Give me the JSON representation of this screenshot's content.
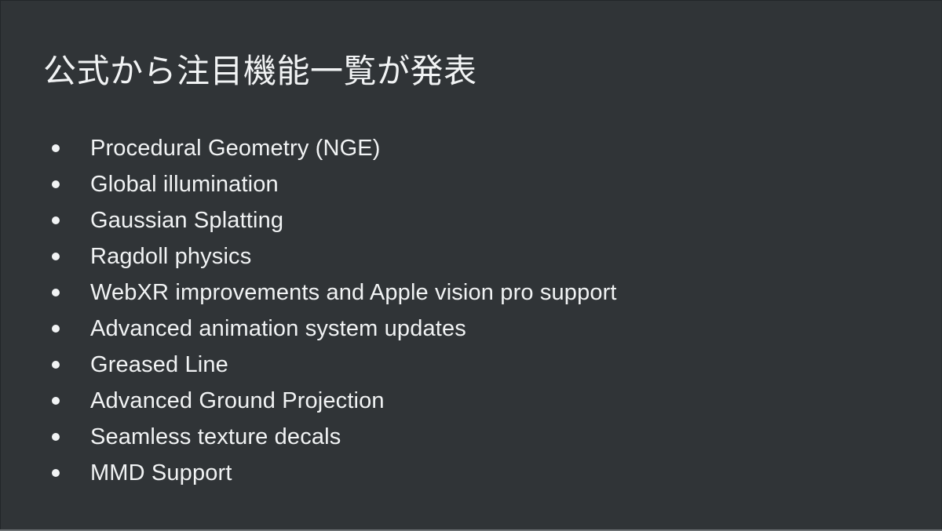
{
  "slide": {
    "title": "公式から注目機能一覧が発表",
    "background_color": "#303437",
    "text_color": "#f1f3f4",
    "bullet_marker": "filled-circle",
    "bullets": [
      {
        "label": "Procedural Geometry (NGE)"
      },
      {
        "label": "Global illumination"
      },
      {
        "label": "Gaussian Splatting"
      },
      {
        "label": "Ragdoll physics"
      },
      {
        "label": "WebXR improvements and Apple vision pro support"
      },
      {
        "label": "Advanced animation system updates"
      },
      {
        "label": "Greased Line"
      },
      {
        "label": "Advanced Ground Projection"
      },
      {
        "label": "Seamless texture decals"
      },
      {
        "label": "MMD Support"
      }
    ]
  }
}
